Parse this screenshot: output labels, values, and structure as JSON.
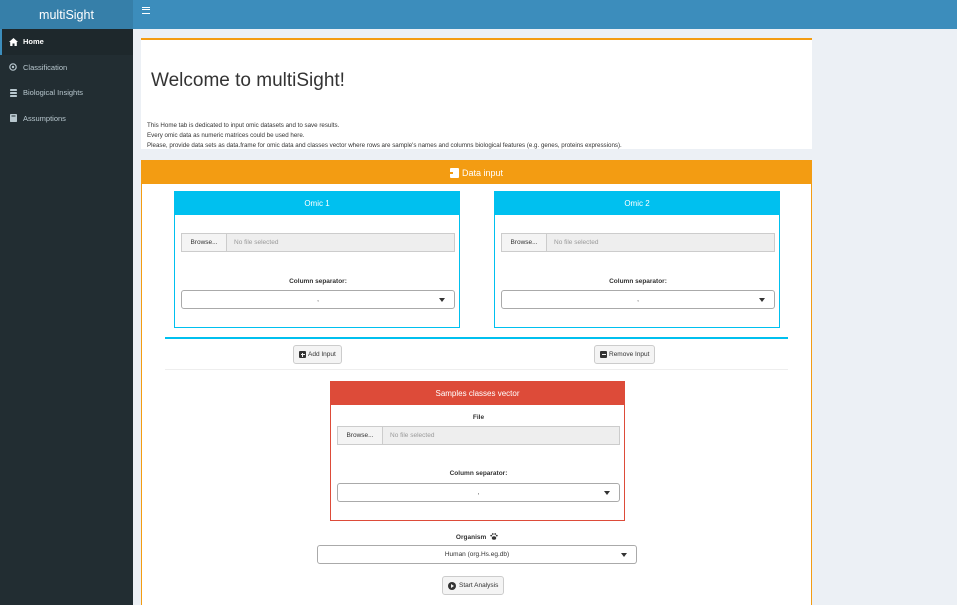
{
  "app": {
    "title": "multiSight"
  },
  "sidebar": {
    "items": [
      {
        "label": "Home",
        "icon": "home-icon",
        "active": true
      },
      {
        "label": "Classification",
        "icon": "target-icon",
        "active": false
      },
      {
        "label": "Biological Insights",
        "icon": "database-icon",
        "active": false
      },
      {
        "label": "Assumptions",
        "icon": "book-icon",
        "active": false
      }
    ]
  },
  "welcome": {
    "heading": "Welcome to multiSight!",
    "line1": "This Home tab is dedicated to input omic datasets and to save results.",
    "line2": "Every omic data as numeric matrices could be used here.",
    "line3": "Please, provide data sets as data.frame for omic data and classes vector where rows are sample's names and columns biological features (e.g. genes, proteins expressions)."
  },
  "data_input": {
    "title": "Data input",
    "omics": [
      {
        "title": "Omic 1",
        "browse": "Browse...",
        "file": "No file selected",
        "sep_label": "Column separator:",
        "sep_value": ","
      },
      {
        "title": "Omic 2",
        "browse": "Browse...",
        "file": "No file selected",
        "sep_label": "Column separator:",
        "sep_value": ","
      }
    ],
    "add_input": "Add Input",
    "remove_input": "Remove Input",
    "classes": {
      "title": "Samples classes vector",
      "file_label": "File",
      "browse": "Browse...",
      "file": "No file selected",
      "sep_label": "Column separator:",
      "sep_value": ","
    },
    "organism_label": "Organism",
    "organism_value": "Human (org.Hs.eg.db)",
    "start": "Start Analysis"
  },
  "colors": {
    "header": "#3c8dbc",
    "sidebar": "#222d32",
    "warning": "#f39c12",
    "info": "#00c0ef",
    "danger": "#dd4b39"
  }
}
